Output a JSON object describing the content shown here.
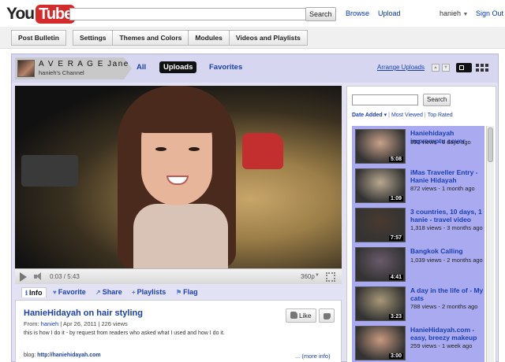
{
  "masthead": {
    "logo_you": "You",
    "logo_tube": "Tube",
    "search_button": "Search",
    "search_value": "",
    "browse": "Browse",
    "upload": "Upload",
    "username": "hanieh",
    "sign_out": "Sign Out"
  },
  "toolbar": {
    "post_bulletin": "Post Bulletin",
    "settings": "Settings",
    "themes": "Themes and Colors",
    "modules": "Modules",
    "videos_playlists": "Videos and Playlists"
  },
  "channel": {
    "name": "A V E R A G E Jane",
    "subtitle": "hanieh's Channel",
    "tabs": [
      "All",
      "Uploads",
      "Favorites"
    ],
    "active_tab": "Uploads",
    "arrange": "Arrange Uploads"
  },
  "player": {
    "time": "0:03 / 5:43",
    "quality": "360p",
    "progress": 0.009
  },
  "actions": [
    "Info",
    "Favorite",
    "Share",
    "Playlists",
    "Flag"
  ],
  "video": {
    "title": "HanieHidayah on hair styling",
    "from_label": "From:",
    "author": "hanieh",
    "date": "Apr 26, 2011",
    "views": "226 views",
    "description": "this is how I do it - by request from readers who asked what I used and how I do it.",
    "blog_label": "blog:",
    "blog_url": "http://haniehidayah.com",
    "more_info": "... (more info)",
    "like": "Like"
  },
  "sidebar": {
    "search_button": "Search",
    "sort_active": "Date Added",
    "sort_most_viewed": "Most Viewed",
    "sort_top_rated": "Top Rated",
    "videos": [
      {
        "title": "Haniehidayah impromptu cover",
        "meta": "392 views - 6 days ago",
        "duration": "5:08",
        "thumb_color": "#c9a18a"
      },
      {
        "title": "iMas Traveller Entry - Hanie Hidayah",
        "meta": "872 views - 1 month ago",
        "duration": "1:09",
        "thumb_color": "#b9a890"
      },
      {
        "title": "3 countries, 10 days, 1 hanie - travel video",
        "meta": "1,318 views - 3 months ago",
        "duration": "7:57",
        "thumb_color": "#4a3a30"
      },
      {
        "title": "Bangkok Calling",
        "meta": "1,039 views - 2 months ago",
        "duration": "4:41",
        "thumb_color": "#6a5a6a"
      },
      {
        "title": "A day in the life of - My cats",
        "meta": "788 views - 2 months ago",
        "duration": "3:23",
        "thumb_color": "#a89878"
      },
      {
        "title": "HanieHidayah.com - easy, breezy makeup",
        "meta": "259 views - 1 week ago",
        "duration": "3:00",
        "thumb_color": "#c89a80"
      }
    ]
  }
}
